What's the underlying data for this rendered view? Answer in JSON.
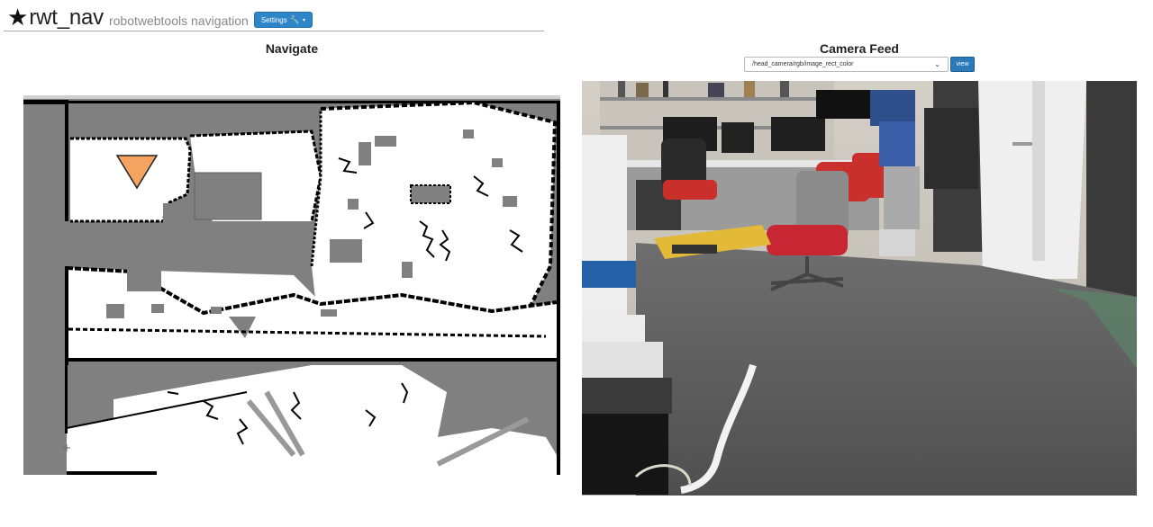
{
  "header": {
    "title": "rwt_nav",
    "subtitle": "robotwebtools navigation",
    "settings_label": "Settings",
    "star_icon": "star-icon",
    "wrench_icon": "wrench-icon"
  },
  "navigate": {
    "title": "Navigate",
    "robot_marker_color": "#f4a460"
  },
  "camera": {
    "title": "Camera Feed",
    "topic_selected": "/head_camera/rgb/image_rect_color",
    "view_label": "view"
  },
  "colors": {
    "button_blue": "#2e86c9",
    "map_unknown": "#808080",
    "map_free": "#ffffff",
    "map_wall": "#000000"
  }
}
